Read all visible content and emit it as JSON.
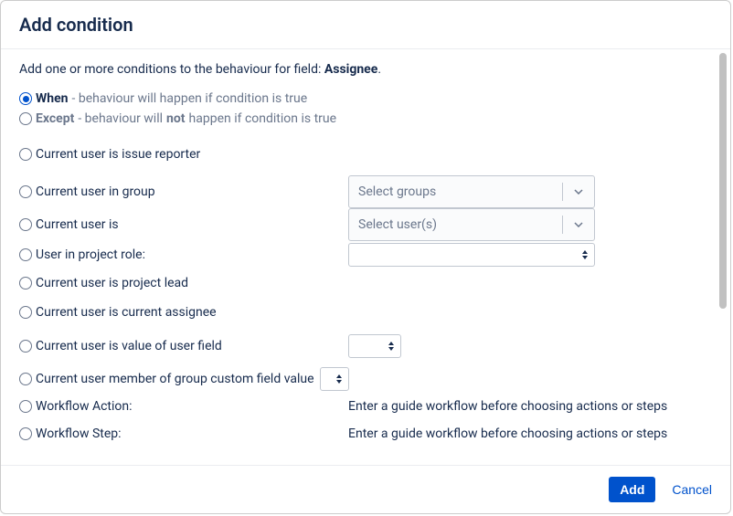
{
  "header": {
    "title": "Add condition"
  },
  "intro": {
    "prefix": "Add one or more conditions to the behaviour for field: ",
    "field_name": "Assignee",
    "suffix": "."
  },
  "mode": {
    "when_bold": "When",
    "when_desc": " - behaviour will happen if condition is true",
    "except_bold": "Except",
    "except_desc_a": " - behaviour will ",
    "except_desc_not": "not",
    "except_desc_b": " happen if condition is true"
  },
  "conditions": {
    "issue_reporter": "Current user is issue reporter",
    "user_in_group": "Current user in group",
    "user_is": "Current user is",
    "project_role": "User in project role:",
    "project_lead": "Current user is project lead",
    "current_assignee": "Current user is current assignee",
    "value_user_field": "Current user is value of user field",
    "member_group_cf": "Current user member of group custom field value",
    "workflow_action": "Workflow Action:",
    "workflow_step": "Workflow Step:"
  },
  "selects": {
    "groups_placeholder": "Select groups",
    "users_placeholder": "Select user(s)"
  },
  "hints": {
    "workflow_action_hint": "Enter a guide workflow before choosing actions or steps",
    "workflow_step_hint": "Enter a guide workflow before choosing actions or steps"
  },
  "footer": {
    "add": "Add",
    "cancel": "Cancel"
  }
}
